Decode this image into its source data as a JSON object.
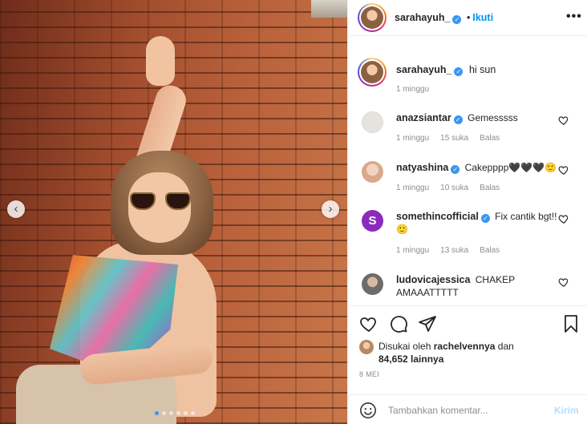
{
  "post": {
    "author": "sarahayuh_",
    "separator": "•",
    "follow_label": "Ikuti",
    "more_label": "•••",
    "caption": "hi sun",
    "caption_time": "1 minggu",
    "image_dots": {
      "count": 6,
      "active_index": 0
    }
  },
  "comments": [
    {
      "user": "anazsiantar",
      "text": "Gemesssss",
      "time": "1 minggu",
      "likes": "15 suka",
      "reply": "Balas",
      "avatar_color": "#e7e2dd"
    },
    {
      "user": "natyashina",
      "text": "Cakepppp🖤🖤🖤🙂",
      "time": "1 minggu",
      "likes": "10 suka",
      "reply": "Balas",
      "avatar_color": "#e9c9b6"
    },
    {
      "user": "somethincofficial",
      "text": "Fix cantik bgt!!🙂",
      "time": "1 minggu",
      "likes": "13 suka",
      "reply": "Balas",
      "avatar_color": "#8a2bbd",
      "avatar_letter": "S"
    },
    {
      "user": "ludovicajessica",
      "text": "CHAKEP AMAAATTTTT",
      "avatar_color": "#8e8a86"
    }
  ],
  "likes": {
    "prefix": "Disukai oleh",
    "user": "rachelvennya",
    "middle": "dan",
    "count": "84,652 lainnya"
  },
  "date": "8 MEI",
  "add_comment": {
    "placeholder": "Tambahkan komentar...",
    "post_label": "Kirim"
  },
  "icons": {
    "like": "heart-icon",
    "comment": "comment-icon",
    "share": "share-icon",
    "save": "bookmark-icon",
    "emoji": "emoji-icon",
    "verified": "verified-badge-icon"
  },
  "colors": {
    "link_blue": "#0095f6",
    "verified": "#3897f0",
    "muted": "#8e8e8e",
    "post_disabled": "#b2dffc"
  }
}
